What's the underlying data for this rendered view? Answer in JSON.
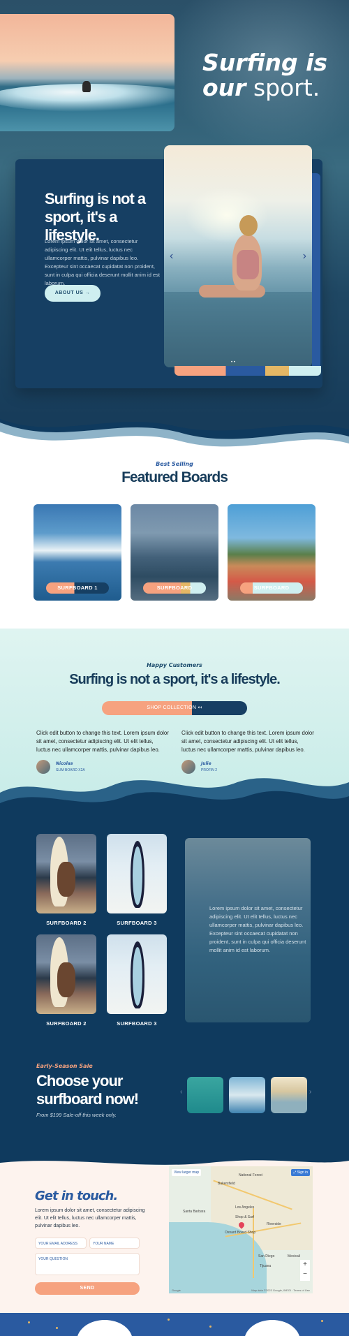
{
  "hero": {
    "title_line1": "Surfing is",
    "title_line2_bold": "our",
    "title_line2_rest": " sport.",
    "about_title": "Surfing is not a sport, it's a lifestyle.",
    "about_text": "Lorem ipsum dolor sit amet, consectetur adipiscing elit. Ut elit tellus, luctus nec ullamcorper mattis, pulvinar dapibus leo. Excepteur sint occaecat cupidatat non proident, sunt in culpa qui officia deserunt mollit anim id est laborum.",
    "about_button": "ABOUT US →",
    "slider_prev": "‹",
    "slider_next": "›",
    "slider_dots": "• •"
  },
  "featured": {
    "kicker": "Best Selling",
    "title": "Featured Boards",
    "boards": [
      {
        "label": "SURFBOARD 1"
      },
      {
        "label": "SURFBOARD"
      },
      {
        "label": "SURFBOARD"
      }
    ]
  },
  "customers": {
    "kicker": "Happy Customers",
    "title": "Surfing is not a sport, it's a lifestyle.",
    "shop_button": "SHOP COLLECTION ↤",
    "testimonials": [
      {
        "text": "Click edit button to change this text. Lorem ipsum dolor sit amet, consectetur adipiscing elit. Ut elit tellus, luctus nec ullamcorper mattis, pulvinar dapibus leo.",
        "name": "Nicolas",
        "role": "SLIM BOARD X2A"
      },
      {
        "text": "Click edit button to change this text. Lorem ipsum dolor sit amet, consectetur adipiscing elit. Ut elit tellus, luctus nec ullamcorper mattis, pulvinar dapibus leo.",
        "name": "Julie",
        "role": "PROFIN 2"
      }
    ]
  },
  "gallery": {
    "items": [
      {
        "label": "SURFBOARD 2"
      },
      {
        "label": "SURFBOARD 3"
      },
      {
        "label": "SURFBOARD 2"
      },
      {
        "label": "SURFBOARD 3"
      }
    ],
    "feature_text": "Lorem ipsum dolor sit amet, consectetur adipiscing elit. Ut elit tellus, luctus nec ullamcorper mattis, pulvinar dapibus leo. Excepteur sint occaecat cupidatat non proident, sunt in culpa qui officia deserunt mollit anim id est laborum."
  },
  "sale": {
    "kicker": "Early-Season Sale",
    "title": "Choose your surfboard now!",
    "subtitle": "From $199 Sale-off this week only.",
    "prev": "‹",
    "next": "›"
  },
  "contact": {
    "title": "Get in touch.",
    "text": "Lorem ipsum dolor sit amet, consectetur adipiscing elit. Ut elit tellus, luctus nec ullamcorper mattis, pulvinar dapibus leo.",
    "email_placeholder": "YOUR EMAIL ADDRESS",
    "name_placeholder": "YOUR NAME",
    "question_placeholder": "YOUR QUESTION",
    "send_button": "SEND"
  },
  "map": {
    "view_larger": "View larger map",
    "enlarge": "⤢ Sign in",
    "zoom_in": "+",
    "zoom_out": "−",
    "labels": [
      "Bakersfield",
      "Santa Barbara",
      "Los Angeles",
      "Shop & Surf",
      "Oxnard Board Shop",
      "Riverside",
      "San Diego",
      "Tijuana",
      "Mexicali",
      "National Forest"
    ],
    "google": "Google",
    "credit": "Map data ©2023 Google, INEGI · Terms of Use"
  },
  "colors": {
    "navy": "#0f3a5e",
    "card": "#163f63",
    "peach": "#f6a27f",
    "mint": "#cfeff0",
    "blue": "#2a5aa0",
    "gold": "#e4b765"
  }
}
